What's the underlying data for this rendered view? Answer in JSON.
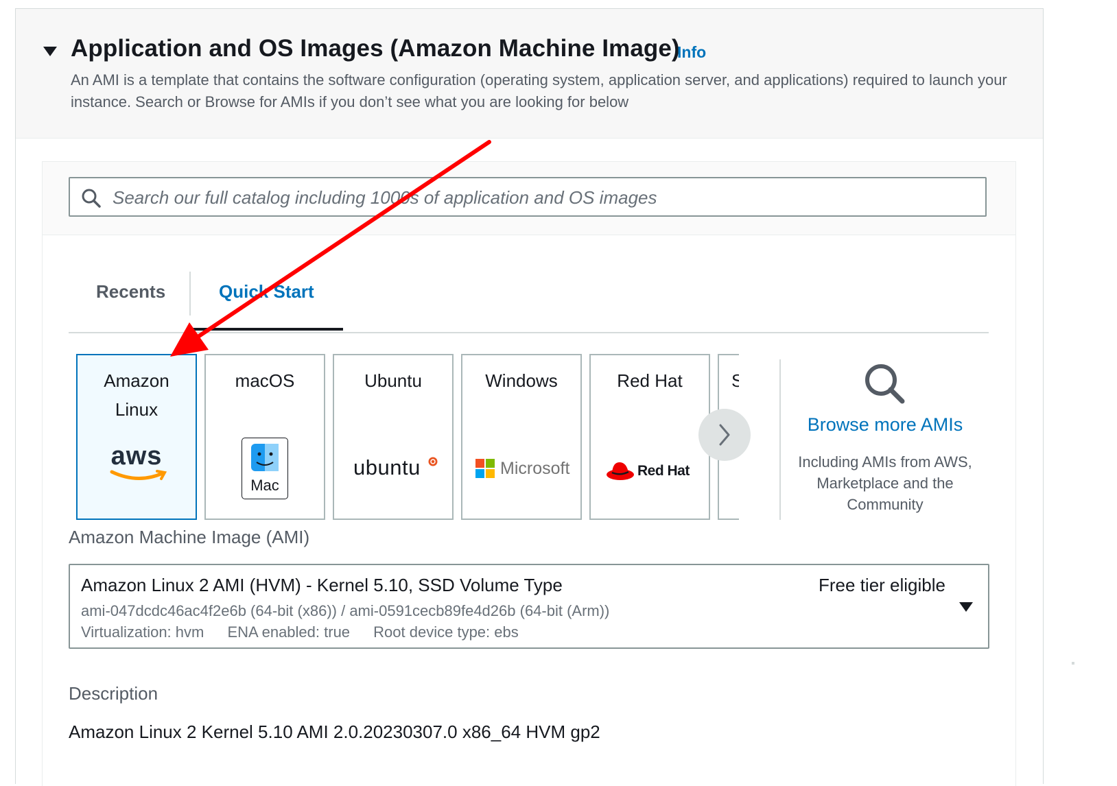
{
  "section": {
    "title": "Application and OS Images (Amazon Machine Image)",
    "info_link": "Info",
    "description": "An AMI is a template that contains the software configuration (operating system, application server, and applications) required to launch your instance. Search or Browse for AMIs if you don’t see what you are looking for below"
  },
  "search": {
    "placeholder": "Search our full catalog including 1000s of application and OS images",
    "value": ""
  },
  "tabs": {
    "recents": "Recents",
    "quick_start": "Quick Start",
    "active": "Quick Start"
  },
  "os_tiles": [
    {
      "label": "Amazon Linux",
      "logo_text": "aws",
      "selected": true
    },
    {
      "label": "macOS",
      "logo_text": "Mac",
      "selected": false
    },
    {
      "label": "Ubuntu",
      "logo_text": "ubuntu",
      "selected": false
    },
    {
      "label": "Windows",
      "logo_text": "Microsoft",
      "selected": false
    },
    {
      "label": "Red Hat",
      "logo_text": "Red Hat",
      "selected": false
    },
    {
      "label": "S",
      "logo_text": "",
      "selected": false
    }
  ],
  "browse": {
    "link": "Browse more AMIs",
    "description": "Including AMIs from AWS, Marketplace and the Community"
  },
  "ami": {
    "label": "Amazon Machine Image (AMI)",
    "name": "Amazon Linux 2 AMI (HVM) - Kernel 5.10, SSD Volume Type",
    "badge": "Free tier eligible",
    "ids": "ami-047dcdc46ac4f2e6b (64-bit (x86)) / ami-0591cecb89fe4d26b (64-bit (Arm))",
    "virtualization": "Virtualization: hvm",
    "ena": "ENA enabled: true",
    "root_device": "Root device type: ebs"
  },
  "description": {
    "label": "Description",
    "value": "Amazon Linux 2 Kernel 5.10 AMI 2.0.20230307.0 x86_64 HVM gp2"
  },
  "colors": {
    "link_blue": "#0073bb",
    "annotation_arrow": "#ff0000",
    "aws_orange": "#ff9900",
    "ubuntu_orange": "#e95420",
    "redhat_red": "#ee0000"
  }
}
